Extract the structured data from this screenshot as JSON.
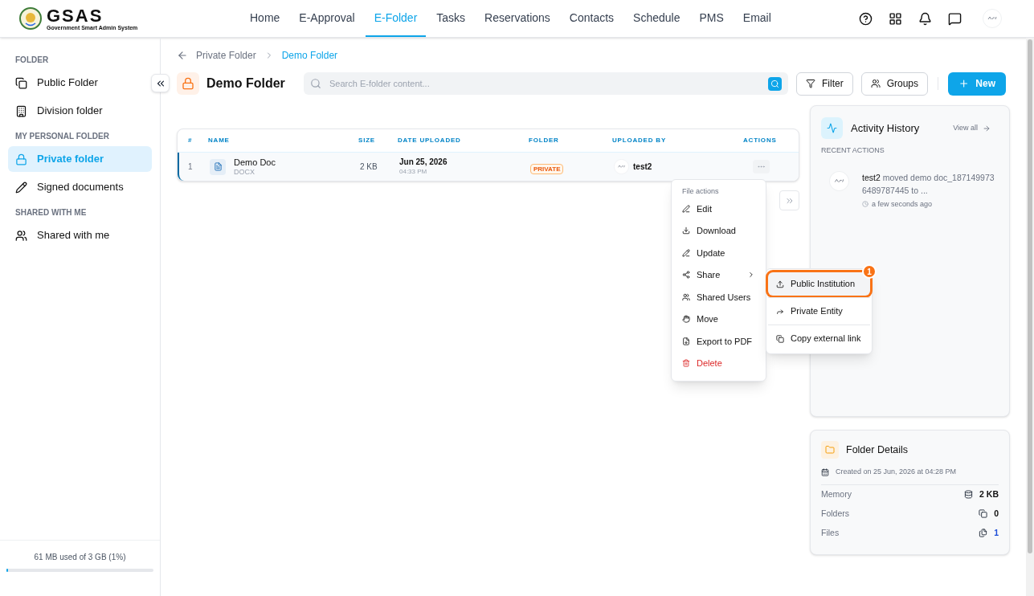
{
  "header": {
    "logo_title": "GSAS",
    "logo_subtitle": "Government Smart Admin System",
    "nav": [
      {
        "label": "Home",
        "selected": false
      },
      {
        "label": "E-Approval",
        "selected": false
      },
      {
        "label": "E-Folder",
        "selected": true
      },
      {
        "label": "Tasks",
        "selected": false
      },
      {
        "label": "Reservations",
        "selected": false
      },
      {
        "label": "Contacts",
        "selected": false
      },
      {
        "label": "Schedule",
        "selected": false
      },
      {
        "label": "PMS",
        "selected": false
      },
      {
        "label": "Email",
        "selected": false
      }
    ]
  },
  "sidebar": {
    "sections": [
      {
        "title": "FOLDER",
        "items": [
          {
            "label": "Public Folder",
            "kind": "public",
            "selected": false
          },
          {
            "label": "Division folder",
            "kind": "division",
            "selected": false
          }
        ]
      },
      {
        "title": "MY PERSONAL FOLDER",
        "items": [
          {
            "label": "Private folder",
            "kind": "private",
            "selected": true
          },
          {
            "label": "Signed documents",
            "kind": "signed",
            "selected": false
          }
        ]
      },
      {
        "title": "SHARED WITH ME",
        "items": [
          {
            "label": "Shared with me",
            "kind": "shared",
            "selected": false
          }
        ]
      }
    ],
    "storage": {
      "text": "61 MB used of 3 GB (1%)",
      "level": 0.01
    }
  },
  "breadcrumb": [
    {
      "label": "Private Folder",
      "selected": false
    },
    {
      "label": "Demo Folder",
      "selected": true
    }
  ],
  "title": "Demo Folder",
  "search": {
    "placeholder": "Search E-folder content..."
  },
  "toolbar": [
    {
      "label": "Filter",
      "kind": "filter"
    },
    {
      "label": "Groups",
      "kind": "groups"
    },
    {
      "label": "New",
      "kind": "new"
    }
  ],
  "table": {
    "columns": [
      "#",
      "NAME",
      "SIZE",
      "DATE UPLOADED",
      "FOLDER",
      "UPLOADED BY",
      "ACTIONS"
    ],
    "rows": [
      {
        "index": "1",
        "name": "Demo Doc",
        "type": "DOCX",
        "size": "2 KB",
        "date": "Jun 25, 2026",
        "time": "04:33 PM",
        "folder": "PRIVATE",
        "uploaded_by": "test2",
        "selected": true
      }
    ]
  },
  "file_menu": {
    "title": "File actions",
    "items": [
      {
        "label": "Edit",
        "kind": "edit",
        "danger": false,
        "has_submenu": false
      },
      {
        "label": "Download",
        "kind": "download",
        "danger": false,
        "has_submenu": false
      },
      {
        "label": "Update",
        "kind": "update",
        "danger": false,
        "has_submenu": false
      },
      {
        "label": "Share",
        "kind": "share",
        "danger": false,
        "has_submenu": true
      },
      {
        "label": "Shared Users",
        "kind": "users",
        "danger": false,
        "has_submenu": false
      },
      {
        "label": "Move",
        "kind": "move",
        "danger": false,
        "has_submenu": false
      },
      {
        "label": "Export to PDF",
        "kind": "pdf",
        "danger": false,
        "has_submenu": false
      },
      {
        "label": "Delete",
        "kind": "delete",
        "danger": true,
        "has_submenu": false
      }
    ]
  },
  "share_menu": {
    "items": [
      {
        "label": "Public Institution",
        "kind": "upload",
        "selected": true,
        "annotation": "1"
      },
      {
        "label": "Private Entity",
        "kind": "forward",
        "selected": false
      },
      {
        "label": "Copy external link",
        "kind": "copy",
        "selected": false
      }
    ]
  },
  "activity": {
    "title": "Activity History",
    "view_all": "View all",
    "subtitle": "RECENT ACTIONS",
    "entries": [
      {
        "text": "**test2** moved demo doc_1871499736489787445 to ...",
        "time": "a few seconds ago"
      }
    ]
  },
  "folder_details": {
    "title": "Folder Details",
    "created": "Created on 25 Jun, 2026 at 04:28 PM",
    "stats": [
      {
        "label": "Memory",
        "value": "2 KB",
        "kind": "memory"
      },
      {
        "label": "Folders",
        "value": "0",
        "kind": "folders"
      },
      {
        "label": "Files",
        "value": "1",
        "kind": "files"
      }
    ]
  }
}
